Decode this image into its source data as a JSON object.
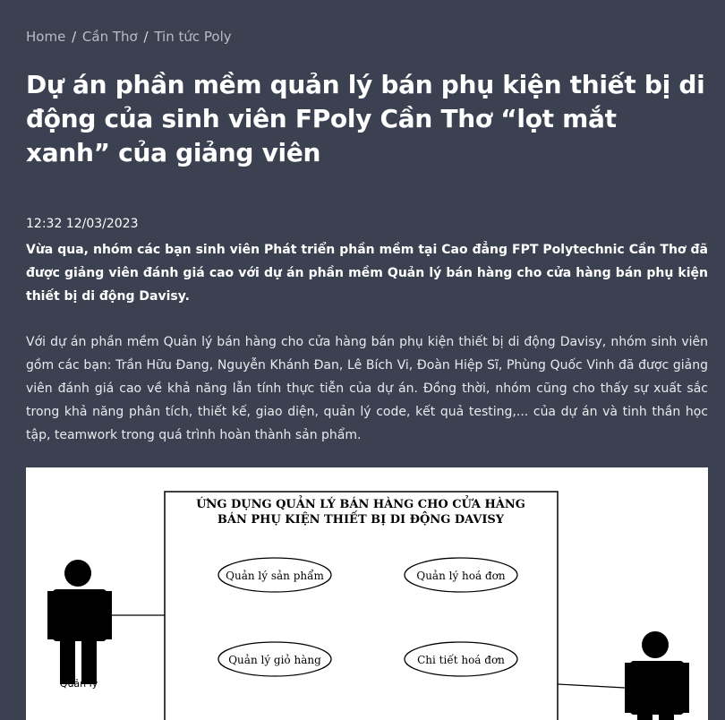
{
  "breadcrumb": {
    "items": [
      "Home",
      "Cần Thơ",
      "Tin tức Poly"
    ],
    "separator": "/"
  },
  "article": {
    "title": "Dự án phần mềm quản lý bán phụ kiện thiết bị di động của sinh viên FPoly Cần Thơ “lọt mắt xanh” của giảng viên",
    "timestamp": "12:32 12/03/2023",
    "lead": "Vừa qua, nhóm các bạn sinh viên Phát triển phần mềm tại Cao đẳng FPT Polytechnic Cần Thơ đã được giảng viên đánh giá cao với dự án phần mềm Quản lý bán hàng cho cửa hàng bán phụ kiện thiết bị di động Davisy.",
    "body": "Với dự án phần mềm Quản lý bán hàng cho cửa hàng bán phụ kiện thiết bị di động Davisy, nhóm sinh viên gồm các bạn: Trần Hữu Đang, Nguyễn Khánh Đan, Lê Bích Vi, Đoàn Hiệp Sĩ, Phùng Quốc Vinh đã được giảng viên đánh giá cao về khả năng lẫn tính thực tiễn của dự án. Đồng thời, nhóm cũng cho thấy sự xuất sắc trong khả năng phân tích, thiết kế, giao diện, quản lý code, kết quả testing,... của dự án và tinh thần học tập, teamwork trong quá trình hoàn thành sản phẩm."
  },
  "diagram": {
    "system_title_line1": "ỨNG DỤNG QUẢN LÝ BÁN HÀNG CHO CỬA HÀNG",
    "system_title_line2": "BÁN PHỤ KIỆN THIẾT BỊ DI ĐỘNG DAVISY",
    "use_cases": [
      "Quản lý sản phẩm",
      "Quản lý hoá đơn",
      "Quản lý giỏ hàng",
      "Chi tiết hoá đơn"
    ],
    "actor_left": "Quản lý"
  },
  "colors": {
    "background": "#3b4150",
    "text": "#ffffff",
    "breadcrumb": "#b9bcc4"
  }
}
